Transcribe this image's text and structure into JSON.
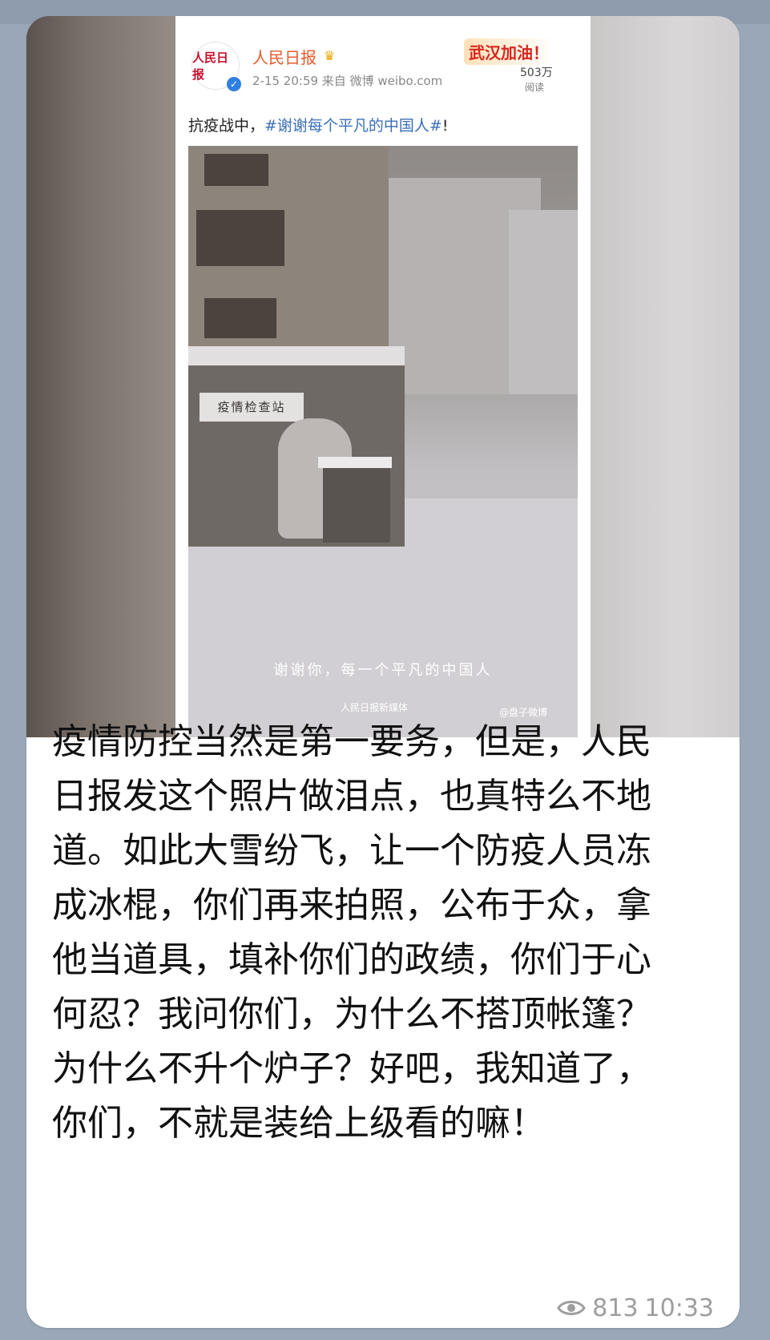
{
  "weibo": {
    "avatar_text": "人民日报",
    "account_name": "人民日报",
    "crown_icon": "crown-icon",
    "meta": "2-15 20:59   来自 微博 weibo.com",
    "badge_title": "武汉加油！",
    "read_count": "503万",
    "read_label": "阅读",
    "post_prefix": "抗疫战中，",
    "post_hashtag": "#谢谢每个平凡的中国人#",
    "post_suffix": "!"
  },
  "photo": {
    "sign_text": "疫情检查站",
    "caption": "谢谢你，每一个平凡的中国人",
    "logo": "人民日报新媒体",
    "watermark": "@盘子微博"
  },
  "message": {
    "text": "疫情防控当然是第一要务，但是，人民日报发这个照片做泪点，也真特么不地道。如此大雪纷飞，让一个防疫人员冻成冰棍，你们再来拍照，公布于众，拿他当道具，填补你们的政绩，你们于心何忍？我问你们，为什么不搭顶帐篷？为什么不升个炉子？好吧，我知道了，你们，不就是装给上级看的嘛！",
    "views": "813",
    "time": "10:33"
  },
  "colors": {
    "background": "#9aa7b8",
    "bubble": "#ffffff",
    "weibo_name": "#e65a2b",
    "hashtag": "#3b6fb6",
    "meta_text": "#9e9e9e"
  }
}
